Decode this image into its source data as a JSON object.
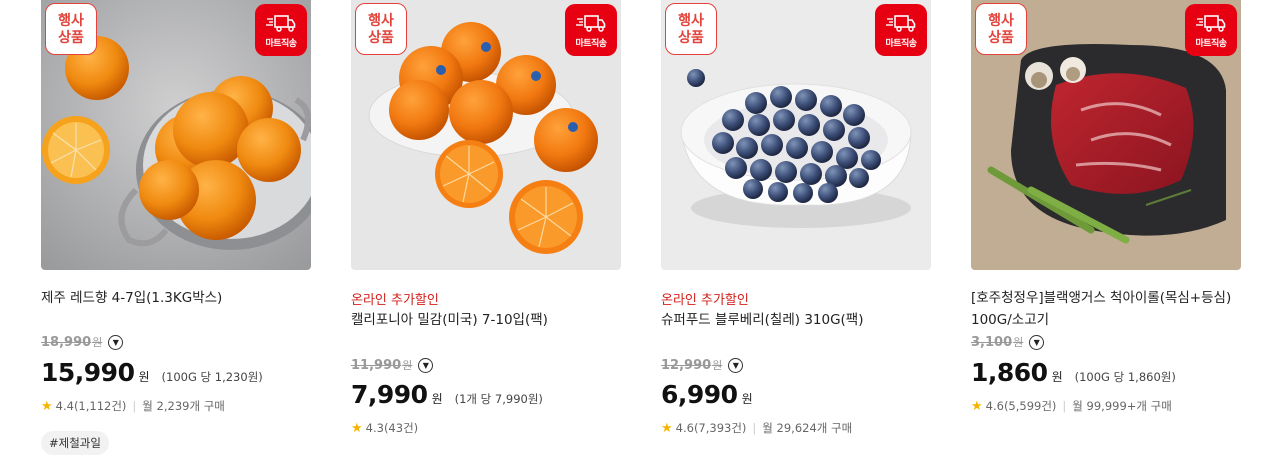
{
  "badges": {
    "event_line1": "행사",
    "event_line2": "상품",
    "mart_ship": "마트직송"
  },
  "products": [
    {
      "promo": "",
      "title": "제주 레드향 4-7입(1.3KG박스)",
      "original_price": "18,990",
      "price": "15,990",
      "won": "원",
      "unit_price": "(100G 당 1,230원)",
      "rating": "4.4(1,112건)",
      "monthly": "월 2,239개 구매",
      "tag": "#제철과일"
    },
    {
      "promo": "온라인 추가할인",
      "title": "캘리포니아 밀감(미국) 7-10입(팩)",
      "original_price": "11,990",
      "price": "7,990",
      "won": "원",
      "unit_price": "(1개 당 7,990원)",
      "rating": "4.3(43건)",
      "monthly": "",
      "tag": ""
    },
    {
      "promo": "온라인 추가할인",
      "title": "슈퍼푸드 블루베리(칠레) 310G(팩)",
      "original_price": "12,990",
      "price": "6,990",
      "won": "원",
      "unit_price": "",
      "rating": "4.6(7,393건)",
      "monthly": "월 29,624개 구매",
      "tag": ""
    },
    {
      "promo": "",
      "title": "[호주청정우]블랙앵거스 척아이롤(목심+등심) 100G/소고기",
      "original_price": "3,100",
      "price": "1,860",
      "won": "원",
      "unit_price": "(100G 당 1,860원)",
      "rating": "4.6(5,599건)",
      "monthly": "월 99,999+개 구매",
      "tag": ""
    }
  ],
  "colors": {
    "accent_red": "#e60012",
    "promo_red": "#d2201c",
    "star": "#f5b400"
  }
}
